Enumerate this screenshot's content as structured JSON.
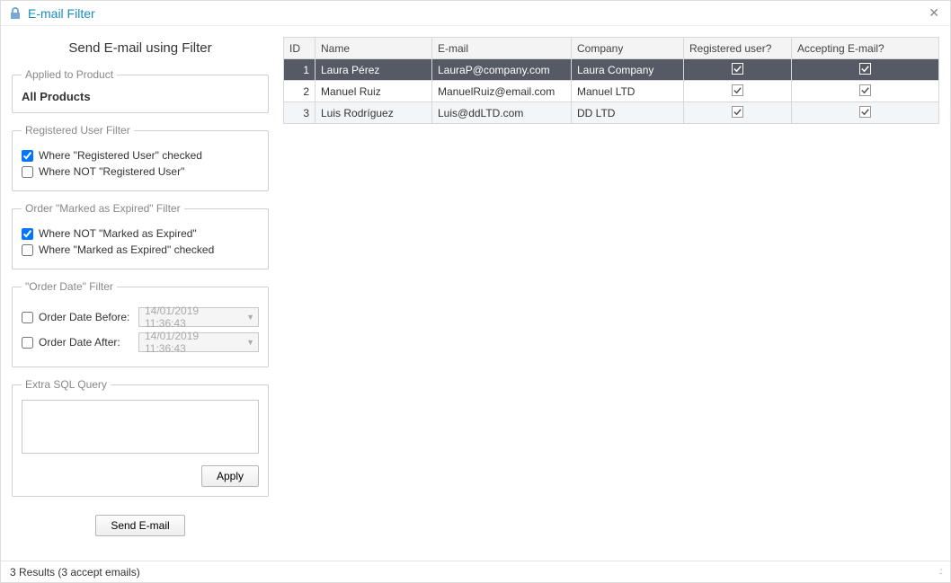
{
  "window": {
    "title": "E-mail Filter"
  },
  "header": {
    "subtitle": "Send E-mail using Filter"
  },
  "productFilter": {
    "legend": "Applied to Product",
    "value": "All Products"
  },
  "regUserFilter": {
    "legend": "Registered User Filter",
    "opt1": "Where \"Registered User\" checked",
    "opt1_checked": true,
    "opt2": "Where NOT \"Registered User\"",
    "opt2_checked": false
  },
  "expiredFilter": {
    "legend": "Order \"Marked as Expired\" Filter",
    "opt1": "Where NOT \"Marked as Expired\"",
    "opt1_checked": true,
    "opt2": "Where \"Marked as Expired\" checked",
    "opt2_checked": false
  },
  "dateFilter": {
    "legend": "\"Order Date\" Filter",
    "beforeLabel": "Order Date Before:",
    "beforeChecked": false,
    "beforeValue": "14/01/2019 11:36:43",
    "afterLabel": "Order Date After:",
    "afterChecked": false,
    "afterValue": "14/01/2019 11:36:43"
  },
  "sqlFilter": {
    "legend": "Extra SQL Query",
    "value": "",
    "applyLabel": "Apply"
  },
  "sendButton": "Send E-mail",
  "table": {
    "headers": {
      "id": "ID",
      "name": "Name",
      "email": "E-mail",
      "company": "Company",
      "registered": "Registered user?",
      "accepting": "Accepting E-mail?"
    },
    "rows": [
      {
        "id": "1",
        "name": "Laura Pérez",
        "email": "LauraP@company.com",
        "company": "Laura Company",
        "registered": true,
        "accepting": true,
        "selected": true
      },
      {
        "id": "2",
        "name": "Manuel Ruiz",
        "email": "ManuelRuiz@email.com",
        "company": "Manuel LTD",
        "registered": true,
        "accepting": true,
        "selected": false
      },
      {
        "id": "3",
        "name": "Luis Rodríguez",
        "email": "Luis@ddLTD.com",
        "company": "DD LTD",
        "registered": true,
        "accepting": true,
        "selected": false
      }
    ]
  },
  "status": {
    "text": "3 Results (3 accept emails)"
  }
}
